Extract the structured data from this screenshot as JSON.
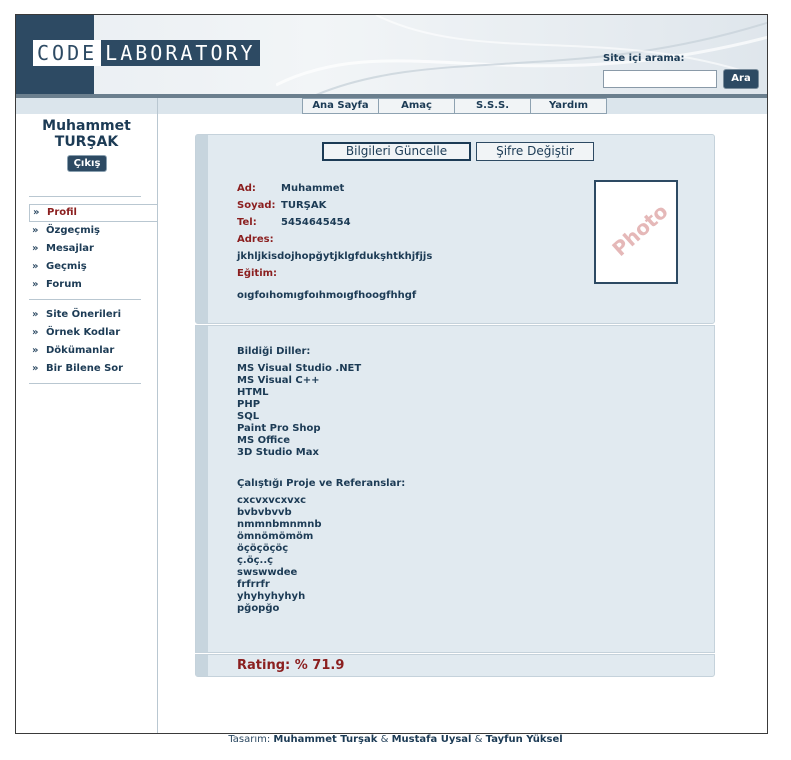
{
  "header": {
    "logo_part1": "CODE",
    "logo_part2": "LABORATORY",
    "search_label": "Site içi arama:",
    "search_value": "",
    "search_button": "Ara"
  },
  "nav": [
    "Ana Sayfa",
    "Amaç",
    "S.S.S.",
    "Yardım"
  ],
  "sidebar": {
    "user_first": "Muhammet",
    "user_last": "TURŞAK",
    "logout": "Çıkış",
    "arrow": "»",
    "menu1": [
      "Profil",
      "Özgeçmiş",
      "Mesajlar",
      "Geçmiş",
      "Forum"
    ],
    "menu2": [
      "Site Önerileri",
      "Örnek Kodlar",
      "Dökümanlar",
      "Bir Bilene Sor"
    ]
  },
  "profile": {
    "tab_update": "Bilgileri Güncelle",
    "tab_password": "Şifre Değiştir",
    "ad_label": "Ad:",
    "ad_value": "Muhammet",
    "soyad_label": "Soyad:",
    "soyad_value": "TURŞAK",
    "tel_label": "Tel:",
    "tel_value": "5454645454",
    "adres_label": "Adres:",
    "adres_value": "jkhljkisdojhopğytjklgfdukşhtkhjfjjs",
    "egitim_label": "Eğitim:",
    "egitim_value": "oıgfoıhomıgfoıhmoıgfhoogfhhgf",
    "photo_text": "Photo"
  },
  "languages": {
    "title": "Bildiği Diller:",
    "items": [
      "MS Visual Studio .NET",
      "MS Visual C++",
      "HTML",
      "PHP",
      "SQL",
      "Paint Pro Shop",
      "MS Office",
      "3D Studio Max"
    ]
  },
  "projects": {
    "title": "Çalıştığı Proje ve Referanslar:",
    "items": [
      "cxcvxvcxvxc",
      "bvbvbvvb",
      "nmmnbmnmnb",
      "ömnömömöm",
      "öçöçöçöç",
      "ç.öç..ç",
      "swswwdee",
      "frfrrfr",
      "yhyhyhyhyh",
      "pğopğo"
    ]
  },
  "rating": "Rating: % 71.9",
  "footer": {
    "prefix": "Tasarım:",
    "name1": "Muhammet Turşak",
    "amp": "&",
    "name2": "Mustafa Uysal",
    "name3": "Tayfun Yüksel"
  }
}
